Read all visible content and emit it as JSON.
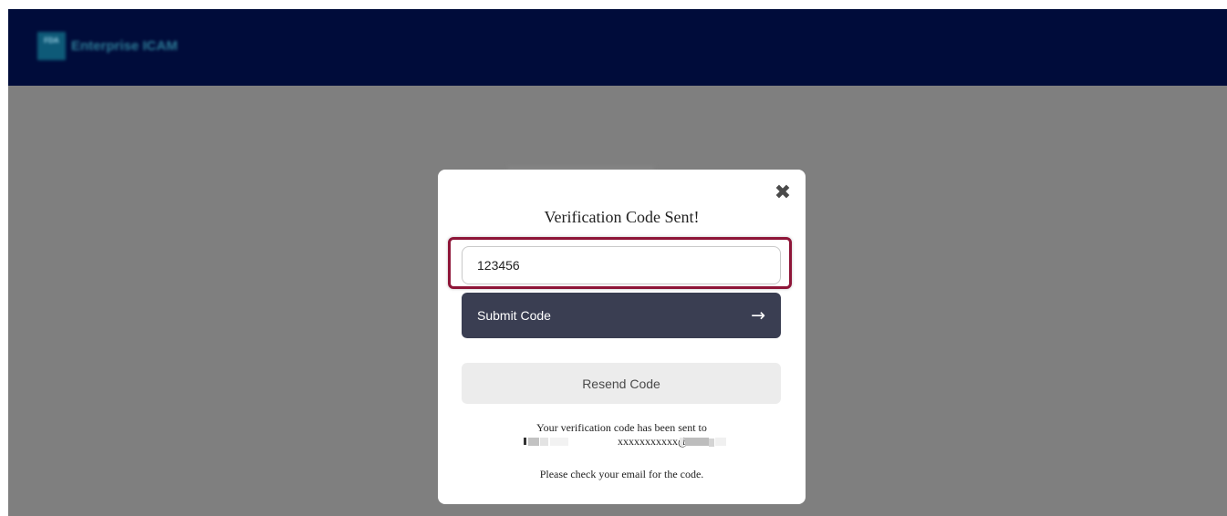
{
  "header": {
    "logo_text": "FDA",
    "app_name": "Enterprise ICAM"
  },
  "modal": {
    "close_glyph": "✖",
    "title": "Verification Code Sent!",
    "code_input": {
      "value": "123456"
    },
    "submit_label": "Submit Code",
    "submit_arrow": "→",
    "resend_label": "Resend Code",
    "sent_message": "Your verification code has been sent to",
    "email_masked": "xxxxxxxxxxx@",
    "check_message": "Please check your email for the code."
  },
  "colors": {
    "header_bg": "#000c3a",
    "overlay_bg": "#7f7f7f",
    "submit_bg": "#3a3e52",
    "resend_bg": "#ececec",
    "highlight_border": "#8e1538"
  }
}
